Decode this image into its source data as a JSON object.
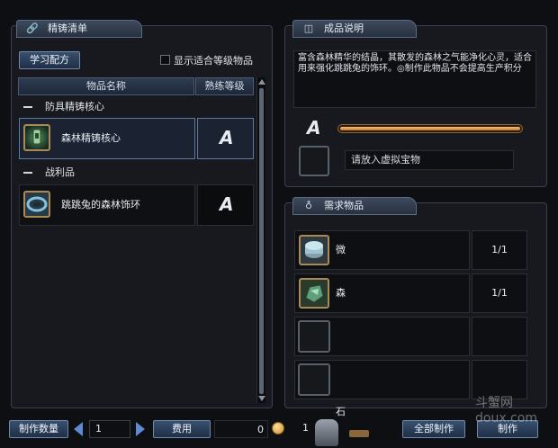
{
  "left": {
    "header": "精铸清单",
    "learn_button": "学习配方",
    "show_level_label": "显示适合等级物品",
    "col_name": "物品名称",
    "col_skill": "熟练等级",
    "categories": [
      {
        "label": "防具精铸核心",
        "items": [
          {
            "name": "森林精铸核心",
            "grade": "A"
          }
        ]
      },
      {
        "label": "战利品",
        "items": [
          {
            "name": "跳跳兔的森林饰环",
            "grade": "A"
          }
        ]
      }
    ]
  },
  "right": {
    "desc_header": "成品说明",
    "desc_text": "富含森林精华的结晶，其散发的森林之气能净化心灵，适合用来强化跳跳兔的饰环。◎制作此物品不会提高生产积分",
    "grade": "A",
    "slot_hint": "请放入虚拟宝物",
    "req_header": "需求物品",
    "requirements": [
      {
        "name": "微光合金",
        "count": "1/1"
      },
      {
        "name": "森林魔石",
        "count": "1/1"
      },
      {
        "name": "",
        "count": ""
      },
      {
        "name": "",
        "count": ""
      }
    ]
  },
  "bottom": {
    "qty_button": "制作数量",
    "qty_value": "1",
    "fee_button": "费用",
    "fee_value": "0",
    "coin_value": "1",
    "make_all_button": "全部制作",
    "make_button": "制作"
  },
  "watermark": "斗蟹网\ndoux.com"
}
